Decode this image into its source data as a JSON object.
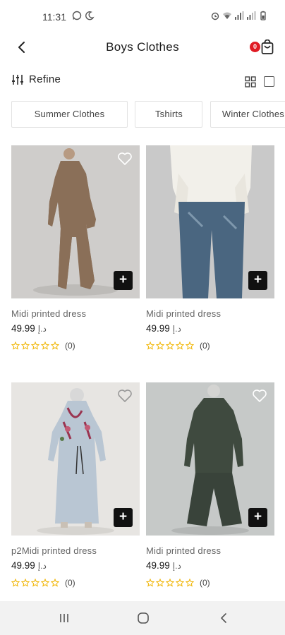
{
  "status_bar": {
    "time": "11:31",
    "left_icons": [
      "whatsapp-icon",
      "moon-icon"
    ],
    "right_icons": [
      "alarm-icon",
      "wifi-icon",
      "signal-icon",
      "signal-icon",
      "battery-icon"
    ]
  },
  "header": {
    "title": "Boys Clothes",
    "cart_count": "0"
  },
  "toolbar": {
    "refine_label": "Refine"
  },
  "categories": [
    {
      "label": "Summer Clothes"
    },
    {
      "label": "Tshirts"
    },
    {
      "label": "Winter Clothes"
    }
  ],
  "products": [
    {
      "name": "Midi printed dress",
      "price": "49.99",
      "currency": "د.إ",
      "rating_count": "(0)"
    },
    {
      "name": "Midi printed dress",
      "price": "49.99",
      "currency": "د.إ",
      "rating_count": "(0)"
    },
    {
      "name": "p2Midi printed dress",
      "price": "49.99",
      "currency": "د.إ",
      "rating_count": "(0)"
    },
    {
      "name": "Midi printed dress",
      "price": "49.99",
      "currency": "د.إ",
      "rating_count": "(0)"
    }
  ],
  "colors": {
    "accent": "#111111",
    "badge": "#e01b24",
    "star": "#f0b400"
  }
}
